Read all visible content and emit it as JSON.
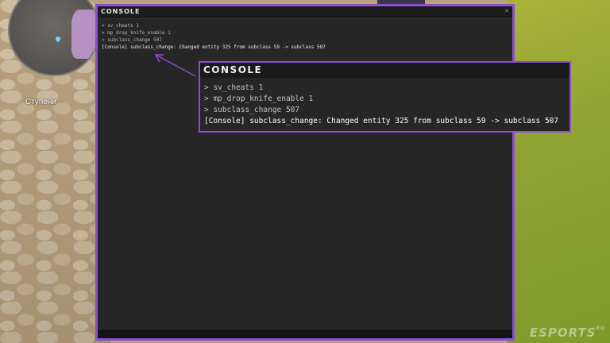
{
  "minimap": {
    "location_label": "Ступени"
  },
  "console": {
    "title": "CONSOLE",
    "close_icon": "x-icon",
    "lines": [
      {
        "text": "> sv_cheats 1",
        "kind": "cmd"
      },
      {
        "text": "> mp_drop_knife_enable 1",
        "kind": "cmd"
      },
      {
        "text": "> subclass_change 507",
        "kind": "cmd"
      },
      {
        "text": "[Console] subclass_change: Changed entity 325 from subclass 59 -> subclass 507",
        "kind": "output"
      }
    ]
  },
  "zoom": {
    "title": "CONSOLE",
    "lines": [
      {
        "text": "> sv_cheats 1",
        "kind": "cmd"
      },
      {
        "text": "> mp_drop_knife_enable 1",
        "kind": "cmd"
      },
      {
        "text": "> subclass_change 507",
        "kind": "cmd"
      },
      {
        "text": "[Console] subclass_change: Changed entity 325 from subclass 59 -> subclass 507",
        "kind": "output"
      }
    ]
  },
  "watermark": {
    "brand": "ESPORTS",
    "suffix": "RU"
  },
  "colors": {
    "accent": "#8a4ecf",
    "panel": "#262626",
    "titlebar": "#1c1c1c"
  }
}
